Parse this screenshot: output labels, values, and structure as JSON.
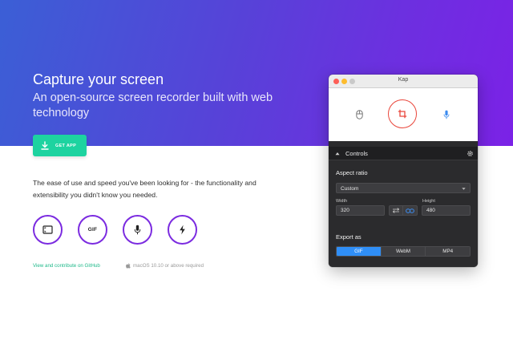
{
  "hero": {
    "title": "Capture your screen",
    "subtitle": "An open-source screen recorder built with web technology",
    "get_app_label": "GET APP",
    "gradient_colors": [
      "#3b5fd6",
      "#7b22e6"
    ]
  },
  "description": "The ease of use and speed you've been looking for - the functionality and extensibility you didn't know you needed.",
  "features": [
    {
      "icon": "screen-capture-icon"
    },
    {
      "icon": "gif-icon",
      "label": "GIF"
    },
    {
      "icon": "microphone-icon"
    },
    {
      "icon": "lightning-icon"
    }
  ],
  "footer": {
    "github_link": "View and contribute on GitHub",
    "requirement": "macOS 10.10 or above required"
  },
  "app_window": {
    "title": "Kap",
    "toolbar_icons": [
      "mouse-icon",
      "crop-icon",
      "microphone-icon"
    ],
    "controls": {
      "header": "Controls",
      "aspect_ratio_label": "Aspect ratio",
      "aspect_ratio_value": "Custom",
      "width_label": "Width",
      "width_value": "320",
      "height_label": "Height",
      "height_value": "480",
      "export_label": "Export as",
      "export_options": [
        "GIF",
        "WebM",
        "MP4"
      ],
      "export_selected": "GIF"
    }
  },
  "colors": {
    "accent_green": "#1dd3a0",
    "accent_purple": "#7b2be0",
    "record_red": "#e9463b",
    "selected_blue": "#2f8ef6"
  }
}
